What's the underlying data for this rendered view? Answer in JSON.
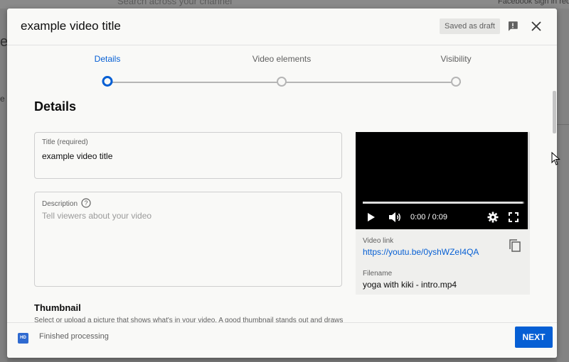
{
  "background": {
    "search_text": "Search across your channel",
    "right_text": "Facebook sign in required,"
  },
  "dialog": {
    "title": "example video title",
    "draft_badge": "Saved as draft",
    "icons": {
      "feedback": "feedback-icon",
      "close": "close-icon"
    }
  },
  "stepper": {
    "steps": [
      {
        "label": "Details",
        "active": true
      },
      {
        "label": "Video elements",
        "active": false
      },
      {
        "label": "Visibility",
        "active": false
      }
    ]
  },
  "details": {
    "section_title": "Details",
    "title_field": {
      "label": "Title (required)",
      "value": "example video title"
    },
    "description_field": {
      "label": "Description",
      "placeholder": "Tell viewers about your video",
      "help_icon": "help-icon"
    },
    "thumbnail": {
      "title": "Thumbnail",
      "description": "Select or upload a picture that shows what's in your video. A good thumbnail stands out and draws viewers' attention."
    }
  },
  "preview": {
    "time": "0:00 / 0:09",
    "progress": 0.99,
    "video_link_label": "Video link",
    "video_link": "https://youtu.be/0yshWZeI4QA",
    "filename_label": "Filename",
    "filename": "yoga with kiki - intro.mp4",
    "icons": {
      "play": "play-icon",
      "volume": "volume-icon",
      "settings": "gear-icon",
      "fullscreen": "fullscreen-icon",
      "copy": "copy-icon"
    }
  },
  "footer": {
    "hd_badge": "HD",
    "status": "Finished processing",
    "next_label": "NEXT"
  },
  "colors": {
    "accent": "#065fd4",
    "text_primary": "#0d0d0d",
    "text_secondary": "#606060",
    "surface": "#f9f9f7"
  }
}
